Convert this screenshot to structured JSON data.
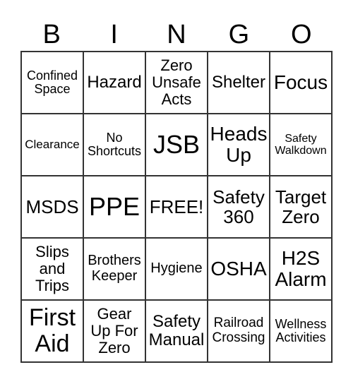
{
  "header": [
    "B",
    "I",
    "N",
    "G",
    "O"
  ],
  "cells": [
    "Confined\nSpace",
    "Hazard",
    "Zero\nUnsafe\nActs",
    "Shelter",
    "Focus",
    "Clearance",
    "No\nShortcuts",
    "JSB",
    "Heads\nUp",
    "Safety\nWalkdown",
    "MSDS",
    "PPE",
    "FREE!",
    "Safety\n360",
    "Target\nZero",
    "Slips\nand\nTrips",
    "Brothers\nKeeper",
    "Hygiene",
    "OSHA",
    "H2S\nAlarm",
    "First\nAid",
    "Gear\nUp For\nZero",
    "Safety\nManual",
    "Railroad\nCrossing",
    "Wellness\nActivities"
  ]
}
